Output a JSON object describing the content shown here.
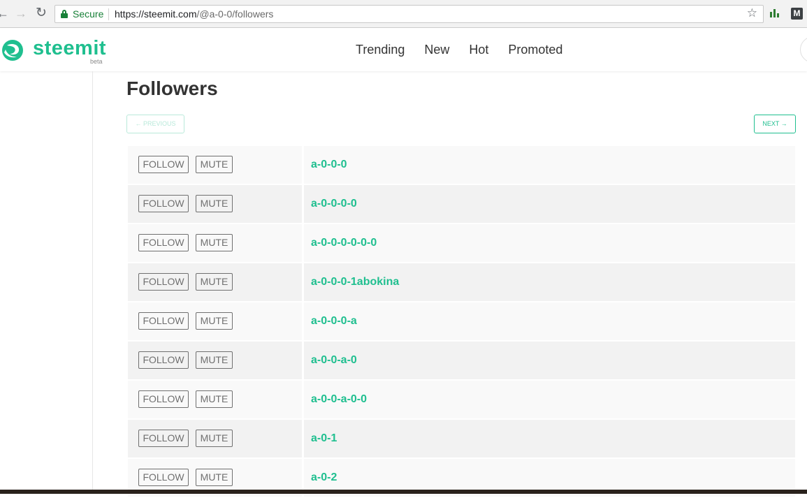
{
  "browser": {
    "secure_label": "Secure",
    "url_host": "https://steemit.com",
    "url_path": "/@a-0-0/followers",
    "ext_m_label": "M"
  },
  "site": {
    "logo_text": "steemit",
    "logo_badge": "beta",
    "nav": [
      "Trending",
      "New",
      "Hot",
      "Promoted"
    ],
    "brand_color": "#1fbf8f"
  },
  "page": {
    "title": "Followers",
    "prev_label": "← PREVIOUS",
    "next_label": "NEXT →",
    "follow_label": "FOLLOW",
    "mute_label": "MUTE"
  },
  "followers": [
    "a-0-0-0",
    "a-0-0-0-0",
    "a-0-0-0-0-0-0",
    "a-0-0-0-1abokina",
    "a-0-0-0-a",
    "a-0-0-a-0",
    "a-0-0-a-0-0",
    "a-0-1",
    "a-0-2"
  ]
}
